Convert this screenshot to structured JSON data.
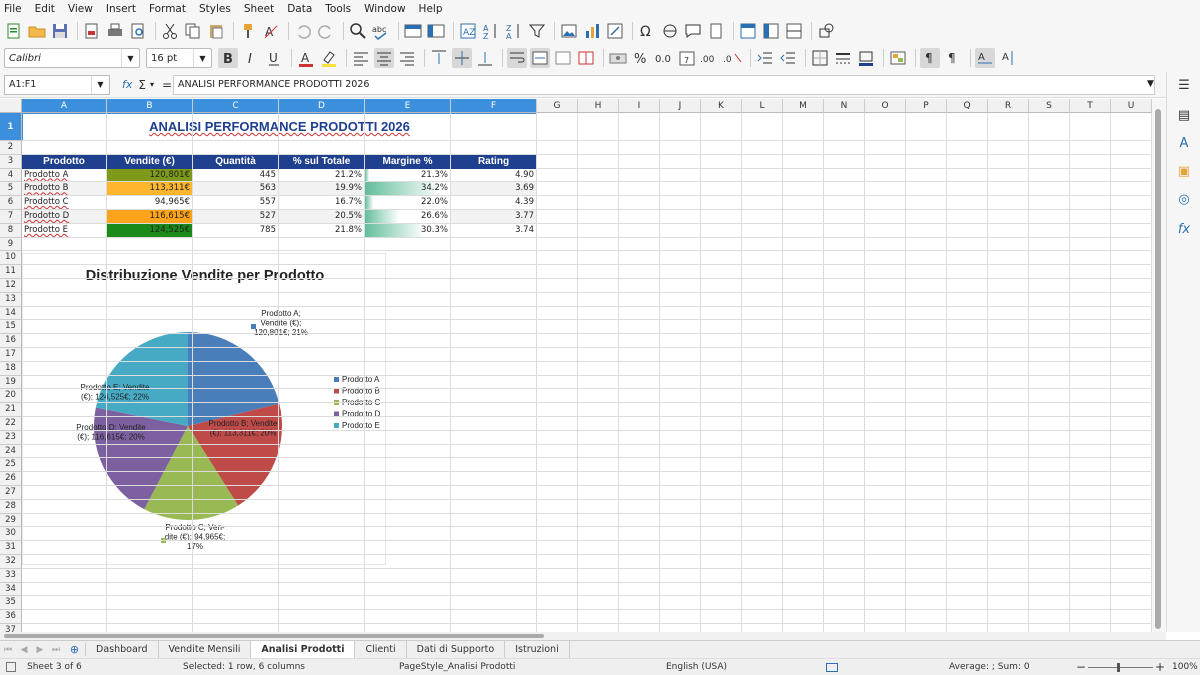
{
  "menu": [
    "File",
    "Edit",
    "View",
    "Insert",
    "Format",
    "Styles",
    "Sheet",
    "Data",
    "Tools",
    "Window",
    "Help"
  ],
  "toolbar": {
    "font_name": "Calibri",
    "font_size": "16 pt"
  },
  "formula_bar": {
    "name_box": "A1:F1",
    "fx_symbol": "fx",
    "sum_symbol": "Σ",
    "equals_symbol": "=",
    "content": "ANALISI PERFORMANCE PRODOTTI 2026"
  },
  "columns": [
    "A",
    "B",
    "C",
    "D",
    "E",
    "F",
    "G",
    "H",
    "I",
    "J",
    "K",
    "L",
    "M",
    "N",
    "O",
    "P",
    "Q",
    "R",
    "S",
    "T",
    "U"
  ],
  "rows": [
    "1",
    "2",
    "3",
    "4",
    "5",
    "6",
    "7",
    "8",
    "9",
    "10",
    "11",
    "12",
    "13",
    "14",
    "15",
    "16",
    "17",
    "18",
    "19",
    "20",
    "21",
    "22",
    "23",
    "24",
    "25",
    "26",
    "27",
    "28",
    "29",
    "30",
    "31",
    "32",
    "33",
    "34",
    "35",
    "36",
    "37"
  ],
  "sheet": {
    "title": "ANALISI PERFORMANCE PRODOTTI 2026",
    "headers": [
      "Prodotto",
      "Vendite (€)",
      "Quantità",
      "% sul Totale",
      "Margine %",
      "Rating"
    ],
    "data": [
      {
        "prodotto": "Prodotto A",
        "vendite": "120,801€",
        "quantita": "445",
        "perc": "21.2%",
        "margine": "21.3%",
        "rating": "4.90"
      },
      {
        "prodotto": "Prodotto B",
        "vendite": "113,311€",
        "quantita": "563",
        "perc": "19.9%",
        "margine": "34.2%",
        "rating": "3.69"
      },
      {
        "prodotto": "Prodotto C",
        "vendite": "94,965€",
        "quantita": "557",
        "perc": "16.7%",
        "margine": "22.0%",
        "rating": "4.39"
      },
      {
        "prodotto": "Prodotto D",
        "vendite": "116,615€",
        "quantita": "527",
        "perc": "20.5%",
        "margine": "26.6%",
        "rating": "3.77"
      },
      {
        "prodotto": "Prodotto E",
        "vendite": "124,525€",
        "quantita": "785",
        "perc": "21.8%",
        "margine": "30.3%",
        "rating": "3.74"
      }
    ],
    "vendite_colors": [
      "#7f9a1a",
      "#ffb52e",
      "#ffffff",
      "#ffa41a",
      "#1a8a1a"
    ],
    "margin_bar_fraction": [
      0.05,
      0.9,
      0.1,
      0.4,
      0.7
    ]
  },
  "chart_data": {
    "type": "pie",
    "title": "Distribuzione Vendite per Prodotto",
    "categories": [
      "Prodotto A",
      "Prodotto B",
      "Prodotto C",
      "Prodotto D",
      "Prodotto E"
    ],
    "values": [
      120801,
      113311,
      94965,
      116615,
      124525
    ],
    "colors": [
      "#4a7ebb",
      "#be4b48",
      "#98b954",
      "#7d60a0",
      "#46aac5"
    ],
    "data_labels": [
      [
        "Prodotto A;",
        "Vendite (€);",
        "120,801€; 21%"
      ],
      [
        "Prodotto B; Vendite",
        "(€); 113,311€; 20%"
      ],
      [
        "Prodotto C; Ven-",
        "dite (€); 94,965€;",
        "17%"
      ],
      [
        "Prodotto D; Vendite",
        "(€); 116,615€; 20%"
      ],
      [
        "Prodotto E; Vendite",
        "(€); 124,525€; 22%"
      ]
    ],
    "legend": [
      "Prodotto A",
      "Prodotto B",
      "Prodotto C",
      "Prodotto D",
      "Prodotto E"
    ],
    "legend_position": "right"
  },
  "tabs": [
    "Dashboard",
    "Vendite Mensili",
    "Analisi Prodotti",
    "Clienti",
    "Dati di Supporto",
    "Istruzioni"
  ],
  "active_tab": "Analisi Prodotti",
  "status": {
    "sheet": "Sheet 3 of 6",
    "selection": "Selected: 1 row, 6 columns",
    "page_style": "PageStyle_Analisi Prodotti",
    "language": "English (USA)",
    "aggregate": "Average: ; Sum: 0",
    "zoom": "100%"
  }
}
